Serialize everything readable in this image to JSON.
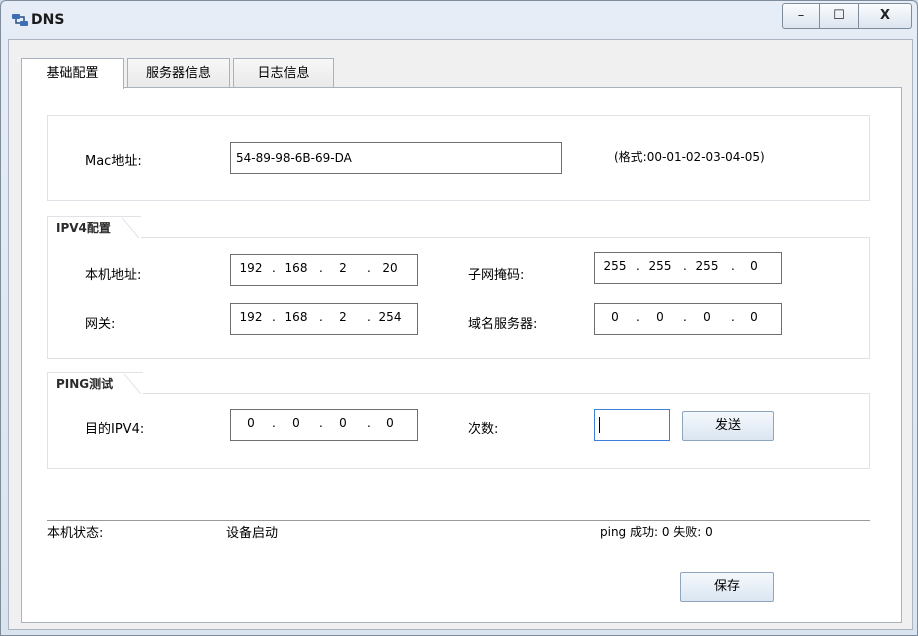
{
  "window": {
    "title": "DNS",
    "controls": {
      "minimize": "–",
      "maximize": "☐",
      "close": "X"
    }
  },
  "tabs": [
    {
      "label": "基础配置",
      "active": true
    },
    {
      "label": "服务器信息",
      "active": false
    },
    {
      "label": "日志信息",
      "active": false
    }
  ],
  "mac": {
    "label": "Mac地址:",
    "value": "54-89-98-6B-69-DA",
    "hint": "(格式:00-01-02-03-04-05)"
  },
  "ipv4": {
    "group_title": "IPV4配置",
    "host_label": "本机地址:",
    "host": [
      "192",
      "168",
      "2",
      "20"
    ],
    "mask_label": "子网掩码:",
    "mask": [
      "255",
      "255",
      "255",
      "0"
    ],
    "gateway_label": "网关:",
    "gateway": [
      "192",
      "168",
      "2",
      "254"
    ],
    "dns_label": "域名服务器:",
    "dns": [
      "0",
      "0",
      "0",
      "0"
    ]
  },
  "ping": {
    "group_title": "PING测试",
    "target_label": "目的IPV4:",
    "target": [
      "0",
      "0",
      "0",
      "0"
    ],
    "count_label": "次数:",
    "count_value": "",
    "send_button": "发送"
  },
  "status": {
    "label": "本机状态:",
    "value": "设备启动",
    "ping_result": "ping 成功: 0 失败: 0"
  },
  "save_button": "保存"
}
